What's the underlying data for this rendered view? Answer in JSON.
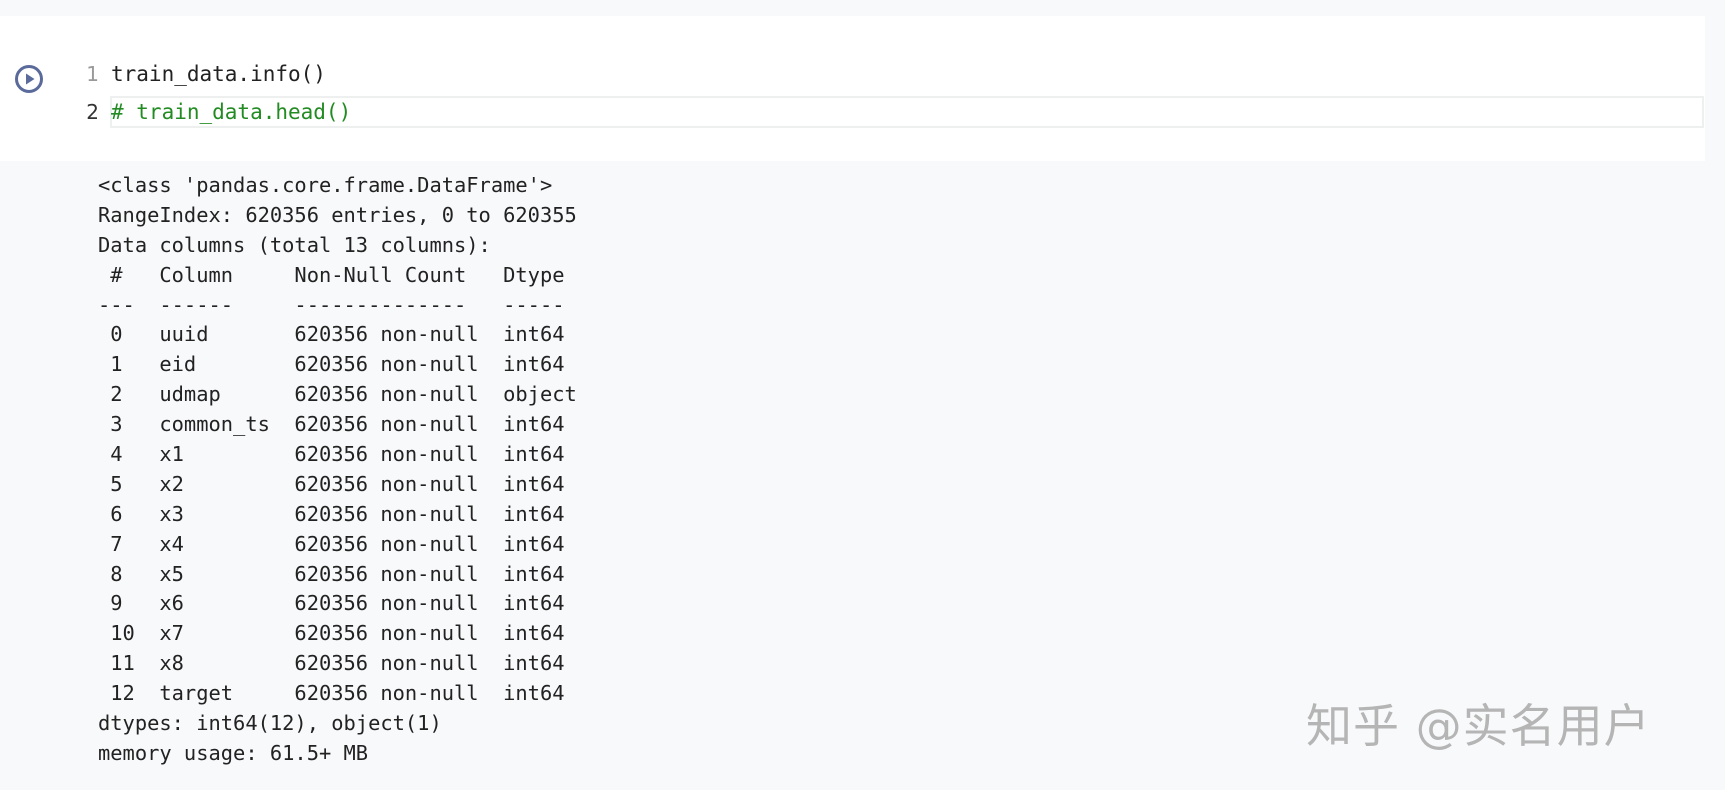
{
  "cell": {
    "run_icon": "play-circle-icon",
    "code_lines": [
      {
        "number": "1",
        "text": "train_data.info()"
      },
      {
        "number": "2",
        "text": "# train_data.head()"
      }
    ]
  },
  "output": {
    "lines": [
      "<class 'pandas.core.frame.DataFrame'>",
      "RangeIndex: 620356 entries, 0 to 620355",
      "Data columns (total 13 columns):",
      " #   Column     Non-Null Count   Dtype ",
      "---  ------     --------------   ----- ",
      " 0   uuid       620356 non-null  int64 ",
      " 1   eid        620356 non-null  int64 ",
      " 2   udmap      620356 non-null  object",
      " 3   common_ts  620356 non-null  int64 ",
      " 4   x1         620356 non-null  int64 ",
      " 5   x2         620356 non-null  int64 ",
      " 6   x3         620356 non-null  int64 ",
      " 7   x4         620356 non-null  int64 ",
      " 8   x5         620356 non-null  int64 ",
      " 9   x6         620356 non-null  int64 ",
      " 10  x7         620356 non-null  int64 ",
      " 11  x8         620356 non-null  int64 ",
      " 12  target     620356 non-null  int64 ",
      "dtypes: int64(12), object(1)",
      "memory usage: 61.5+ MB"
    ]
  },
  "watermark": "知乎 @实名用户",
  "colors": {
    "run_icon": "#5a6a9a",
    "comment": "#228b22",
    "cell_bg": "#ffffff",
    "page_bg": "#f8f9fb"
  }
}
